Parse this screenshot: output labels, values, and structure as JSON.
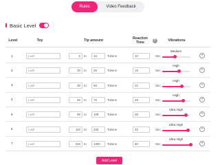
{
  "tabs": [
    {
      "label": "Rules",
      "active": true
    },
    {
      "label": "Video Feedback",
      "active": false
    }
  ],
  "level_section": {
    "title": "Basic Level",
    "enabled": true
  },
  "columns": {
    "level": "Level",
    "toy": "Toy",
    "tip_amount": "Tip amount",
    "reaction_time": "Reaction Time",
    "vibrations": "Vibrations"
  },
  "help_icon": "?",
  "to_label": "to",
  "tokens_label": "Tokens",
  "sec_label": "Sec",
  "add_icon": "+",
  "rows": [
    {
      "level": "1",
      "toy": "Lush",
      "from": "5",
      "to": "15",
      "reaction": "10",
      "vibration": "Medium",
      "intensity": 0.45
    },
    {
      "level": "2",
      "toy": "Lush",
      "from": "20",
      "to": "26",
      "reaction": "15",
      "vibration": "High",
      "intensity": 0.6
    },
    {
      "level": "3",
      "toy": "Lush",
      "from": "30",
      "to": "56",
      "reaction": "22",
      "vibration": "High",
      "intensity": 0.7
    },
    {
      "level": "4",
      "toy": "Lush",
      "from": "60",
      "to": "76",
      "reaction": "28",
      "vibration": "High",
      "intensity": 0.75
    },
    {
      "level": "5",
      "toy": "Lush",
      "from": "90",
      "to": "109",
      "reaction": "35",
      "vibration": "Ultra High",
      "intensity": 0.85
    },
    {
      "level": "6",
      "toy": "Lush",
      "from": "110",
      "to": "332",
      "reaction": "45",
      "vibration": "Ultra High",
      "intensity": 0.92
    },
    {
      "level": "7",
      "toy": "Lush",
      "from": "333",
      "to": "1000",
      "reaction": "60",
      "vibration": "Ultra High",
      "intensity": 1.0
    }
  ],
  "add_level_label": "Add Level",
  "colors": {
    "accent": "#f2247a"
  }
}
